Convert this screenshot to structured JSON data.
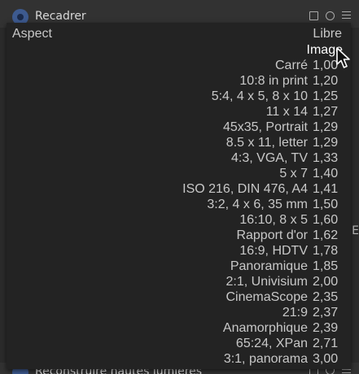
{
  "module": {
    "title": "Recadrer",
    "controls": [
      "presets-icon",
      "reset-icon",
      "menu-icon"
    ]
  },
  "bottom_module": {
    "title": "Reconstruire hautes lumières"
  },
  "side_text": "E",
  "popup": {
    "label": "Aspect",
    "current_value": "Libre",
    "options": [
      {
        "name": "Image",
        "ratio": ""
      },
      {
        "name": "Carré",
        "ratio": "1,00"
      },
      {
        "name": "10:8 in print",
        "ratio": "1,20"
      },
      {
        "name": "5:4, 4 x 5, 8 x 10",
        "ratio": "1,25"
      },
      {
        "name": "11 x 14",
        "ratio": "1,27"
      },
      {
        "name": "45x35, Portrait",
        "ratio": "1,29"
      },
      {
        "name": "8.5 x 11, letter",
        "ratio": "1,29"
      },
      {
        "name": "4:3, VGA, TV",
        "ratio": "1,33"
      },
      {
        "name": "5 x 7",
        "ratio": "1,40"
      },
      {
        "name": "ISO 216, DIN 476, A4",
        "ratio": "1,41"
      },
      {
        "name": "3:2, 4 x 6, 35 mm",
        "ratio": "1,50"
      },
      {
        "name": "16:10, 8 x 5",
        "ratio": "1,60"
      },
      {
        "name": "Rapport d'or",
        "ratio": "1,62"
      },
      {
        "name": "16:9, HDTV",
        "ratio": "1,78"
      },
      {
        "name": "Panoramique",
        "ratio": "1,85"
      },
      {
        "name": "2:1, Univisium",
        "ratio": "2,00"
      },
      {
        "name": "CinemaScope",
        "ratio": "2,35"
      },
      {
        "name": "21:9",
        "ratio": "2,37"
      },
      {
        "name": "Anamorphique",
        "ratio": "2,39"
      },
      {
        "name": "65:24, XPan",
        "ratio": "2,71"
      },
      {
        "name": "3:1, panorama",
        "ratio": "3,00"
      }
    ]
  },
  "colors": {
    "background": "#2b2b2b",
    "popup_background": "#232323",
    "text": "#c8c8c8",
    "highlight_text": "#ffffff",
    "module_icon": "#3d5a8f"
  }
}
